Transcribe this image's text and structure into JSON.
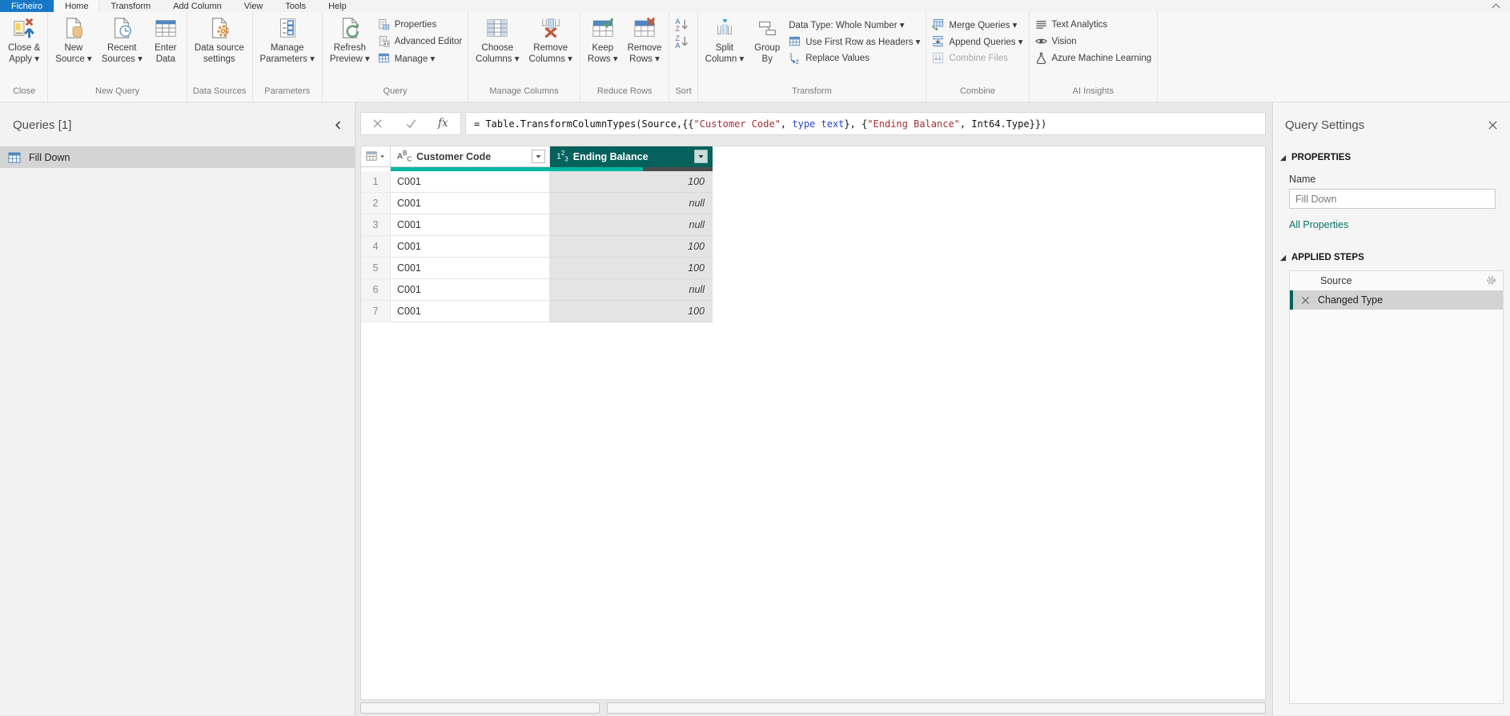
{
  "colors": {
    "file_tab_blue": "#1878c8",
    "header_selected_teal": "#04615c",
    "quality_valid_teal": "#00b7a0",
    "quality_missing_grey": "#4d4d4d",
    "link_teal": "#077368",
    "formula_string": "#a33030",
    "formula_keyword": "#2744d1"
  },
  "titlebar": {
    "collapse_ribbon_icon": "chevron-up-icon"
  },
  "menu": {
    "tabs": [
      {
        "label": "Ficheiro",
        "file": true
      },
      {
        "label": "Home",
        "active": true
      },
      {
        "label": "Transform"
      },
      {
        "label": "Add Column"
      },
      {
        "label": "View"
      },
      {
        "label": "Tools"
      },
      {
        "label": "Help"
      }
    ]
  },
  "ribbon": {
    "groups": [
      {
        "label": "Close",
        "big": [
          {
            "label": "Close &\nApply ▾",
            "icon": "close-apply-icon"
          }
        ]
      },
      {
        "label": "New Query",
        "big": [
          {
            "label": "New\nSource ▾",
            "icon": "new-source-icon"
          },
          {
            "label": "Recent\nSources ▾",
            "icon": "recent-sources-icon"
          },
          {
            "label": "Enter\nData",
            "icon": "enter-data-icon"
          }
        ]
      },
      {
        "label": "Data Sources",
        "big": [
          {
            "label": "Data source\nsettings",
            "icon": "data-source-settings-icon"
          }
        ]
      },
      {
        "label": "Parameters",
        "big": [
          {
            "label": "Manage\nParameters ▾",
            "icon": "manage-parameters-icon"
          }
        ]
      },
      {
        "label": "Query",
        "big": [
          {
            "label": "Refresh\nPreview ▾",
            "icon": "refresh-preview-icon"
          }
        ],
        "stack": [
          {
            "label": "Properties",
            "icon": "properties-icon"
          },
          {
            "label": "Advanced Editor",
            "icon": "advanced-editor-icon"
          },
          {
            "label": "Manage ▾",
            "icon": "manage-icon"
          }
        ]
      },
      {
        "label": "Manage Columns",
        "big": [
          {
            "label": "Choose\nColumns ▾",
            "icon": "choose-columns-icon"
          },
          {
            "label": "Remove\nColumns ▾",
            "icon": "remove-columns-icon"
          }
        ]
      },
      {
        "label": "Reduce Rows",
        "big": [
          {
            "label": "Keep\nRows ▾",
            "icon": "keep-rows-icon"
          },
          {
            "label": "Remove\nRows ▾",
            "icon": "remove-rows-icon"
          }
        ]
      },
      {
        "label": "Sort",
        "icons_only": true,
        "stack": [
          {
            "icon": "az-sort-icon"
          },
          {
            "icon": "za-sort-icon"
          }
        ]
      },
      {
        "label": "Transform",
        "big": [
          {
            "label": "Split\nColumn ▾",
            "icon": "split-column-icon"
          },
          {
            "label": "Group\nBy",
            "icon": "group-by-icon"
          }
        ],
        "stack": [
          {
            "label": "Data Type: Whole Number ▾"
          },
          {
            "label": "Use First Row as Headers ▾",
            "icon": "use-first-row-icon"
          },
          {
            "label": "Replace Values",
            "icon": "replace-values-icon"
          }
        ]
      },
      {
        "label": "Combine",
        "stack": [
          {
            "label": "Merge Queries ▾",
            "icon": "merge-queries-icon"
          },
          {
            "label": "Append Queries ▾",
            "icon": "append-queries-icon"
          },
          {
            "label": "Combine Files",
            "icon": "combine-files-icon",
            "disabled": true
          }
        ]
      },
      {
        "label": "AI Insights",
        "stack": [
          {
            "label": "Text Analytics",
            "icon": "text-analytics-icon"
          },
          {
            "label": "Vision",
            "icon": "vision-icon"
          },
          {
            "label": "Azure Machine Learning",
            "icon": "azure-ml-icon"
          }
        ]
      }
    ]
  },
  "queries_panel": {
    "title": "Queries [1]",
    "items": [
      {
        "label": "Fill Down",
        "selected": true,
        "icon": "query-table-icon"
      }
    ]
  },
  "formula_bar": {
    "segments": [
      {
        "text": "= Table.TransformColumnTypes(Source,{{",
        "kind": "plain"
      },
      {
        "text": "\"Customer Code\"",
        "kind": "string"
      },
      {
        "text": ", ",
        "kind": "plain"
      },
      {
        "text": "type text",
        "kind": "keyword"
      },
      {
        "text": "}, {",
        "kind": "plain"
      },
      {
        "text": "\"Ending Balance\"",
        "kind": "string"
      },
      {
        "text": ", Int64.Type}})",
        "kind": "plain"
      }
    ]
  },
  "table": {
    "columns": [
      {
        "name": "Customer Code",
        "type_glyph": [
          "A",
          "B",
          "C"
        ],
        "selected": false,
        "quality_valid": 1.0
      },
      {
        "name": "Ending Balance",
        "type_glyph": [
          "1",
          "2",
          "3"
        ],
        "selected": true,
        "quality_valid": 0.57
      }
    ],
    "rows": [
      {
        "n": "1",
        "cells": [
          "C001",
          "100"
        ]
      },
      {
        "n": "2",
        "cells": [
          "C001",
          "null"
        ]
      },
      {
        "n": "3",
        "cells": [
          "C001",
          "null"
        ]
      },
      {
        "n": "4",
        "cells": [
          "C001",
          "100"
        ]
      },
      {
        "n": "5",
        "cells": [
          "C001",
          "100"
        ]
      },
      {
        "n": "6",
        "cells": [
          "C001",
          "null"
        ]
      },
      {
        "n": "7",
        "cells": [
          "C001",
          "100"
        ]
      }
    ]
  },
  "settings_panel": {
    "title": "Query Settings",
    "properties_header": "PROPERTIES",
    "name_label": "Name",
    "name_value": "Fill Down",
    "all_properties_label": "All Properties",
    "steps_header": "APPLIED STEPS",
    "steps": [
      {
        "label": "Source",
        "gear": true
      },
      {
        "label": "Changed Type",
        "deletable": true,
        "selected": true
      }
    ]
  }
}
